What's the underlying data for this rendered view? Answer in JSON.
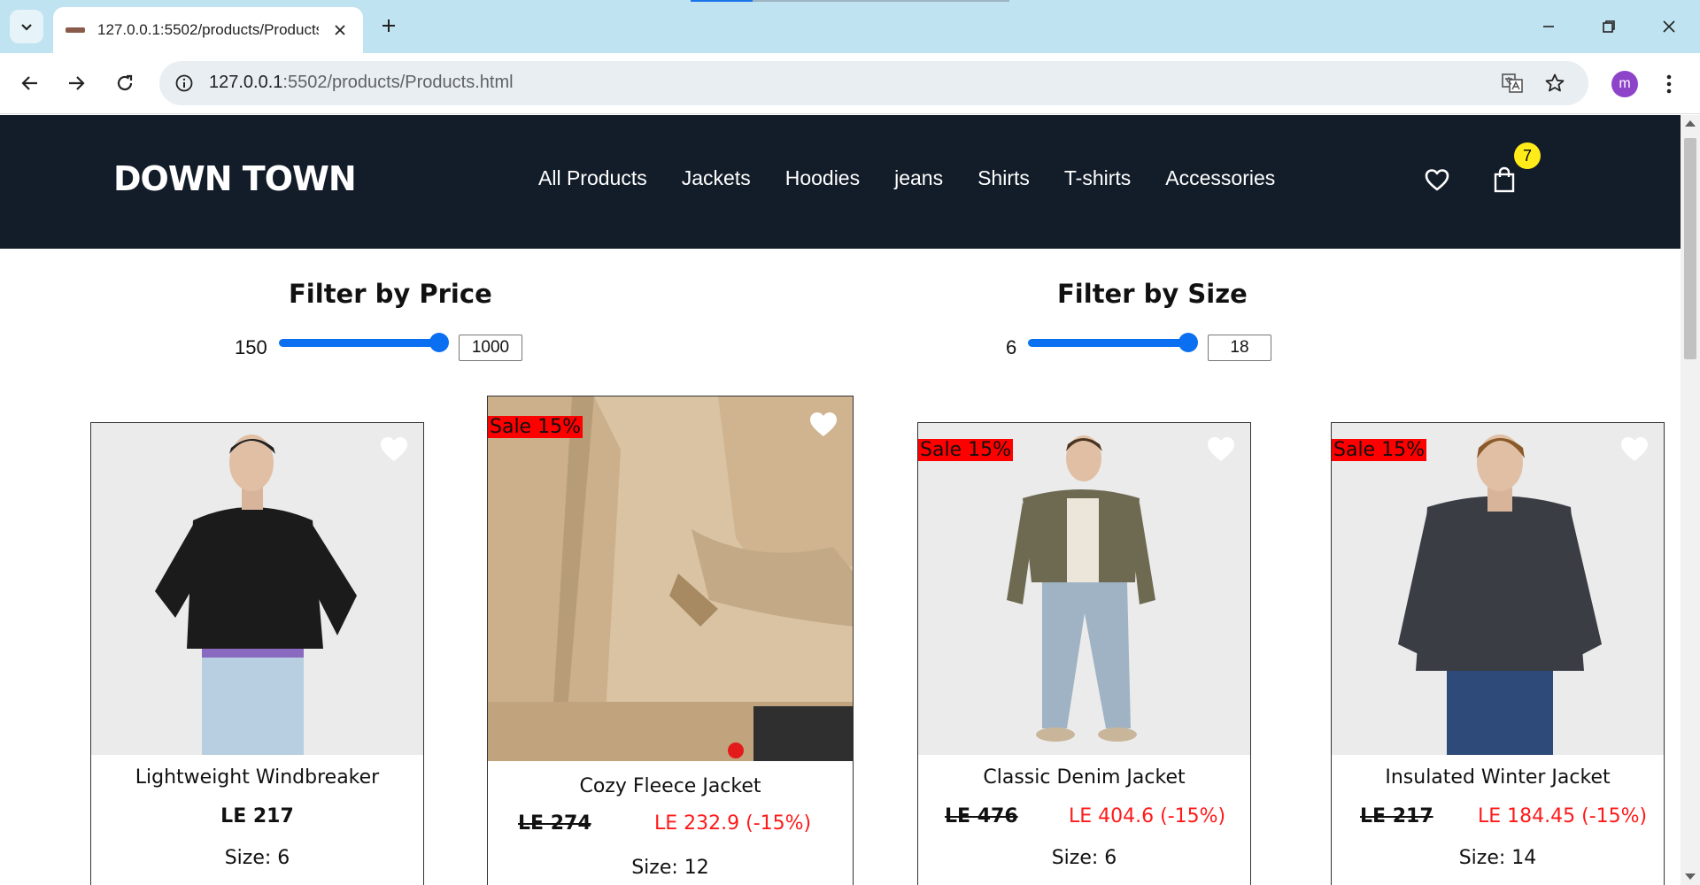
{
  "browser": {
    "tab_title": "127.0.0.1:5502/products/Products.html",
    "url_host": "127.0.0.1",
    "url_rest": ":5502/products/Products.html",
    "profile_initial": "m"
  },
  "header": {
    "logo": "DOWN TOWN",
    "nav": [
      "All Products",
      "Jackets",
      "Hoodies",
      "jeans",
      "Shirts",
      "T-shirts",
      "Accessories"
    ],
    "cart_count": "7"
  },
  "filters": {
    "price": {
      "title": "Filter by Price",
      "min": "150",
      "value": "1000"
    },
    "size": {
      "title": "Filter by Size",
      "min": "6",
      "value": "18"
    }
  },
  "products": [
    {
      "name": "Lightweight Windbreaker",
      "price": "LE 217",
      "size": "Size: 6",
      "sale": ""
    },
    {
      "name": "Cozy Fleece Jacket",
      "old_price": "LE 274",
      "new_price": "LE 232.9 (-15%)",
      "size": "Size: 12",
      "sale": "Sale 15%"
    },
    {
      "name": "Classic Denim Jacket",
      "old_price": "LE 476",
      "new_price": "LE 404.6 (-15%)",
      "size": "Size: 6",
      "sale": "Sale 15%"
    },
    {
      "name": "Insulated Winter Jacket",
      "old_price": "LE 217",
      "new_price": "LE 184.45 (-15%)",
      "size": "Size: 14",
      "sale": "Sale 15%"
    }
  ],
  "colors": {
    "header_bg": "#131c29",
    "accent_blue": "#0a6ff0",
    "sale_red": "#ff0000",
    "badge_yellow": "#ffeb1a"
  }
}
